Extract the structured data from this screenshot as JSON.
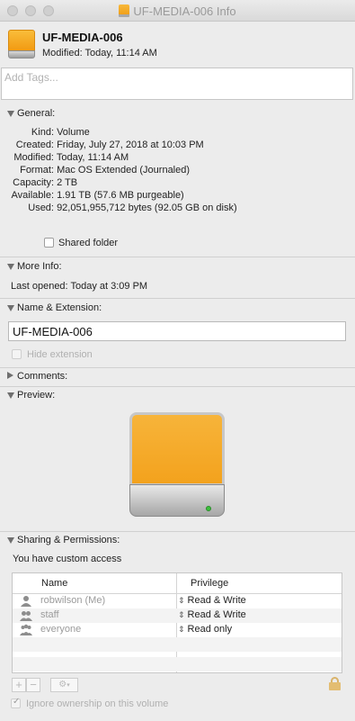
{
  "window": {
    "title": "UF-MEDIA-006 Info"
  },
  "header": {
    "name": "UF-MEDIA-006",
    "modified": "Modified: Today, 11:14 AM"
  },
  "tags": {
    "placeholder": "Add Tags..."
  },
  "general": {
    "label": "General:",
    "rows": [
      {
        "key": "Kind:",
        "value": "Volume"
      },
      {
        "key": "Created:",
        "value": "Friday, July 27, 2018 at 10:03 PM"
      },
      {
        "key": "Modified:",
        "value": "Today, 11:14 AM"
      },
      {
        "key": "Format:",
        "value": "Mac OS Extended (Journaled)"
      },
      {
        "key": "Capacity:",
        "value": "2 TB"
      },
      {
        "key": "Available:",
        "value": "1.91 TB (57.6 MB purgeable)"
      },
      {
        "key": "Used:",
        "value": "92,051,955,712 bytes (92.05 GB on disk)"
      }
    ],
    "shared_folder_label": "Shared folder"
  },
  "more_info": {
    "label": "More Info:",
    "last_opened": "Last opened:",
    "last_opened_value": "Today at 3:09 PM"
  },
  "name_extension": {
    "label": "Name & Extension:",
    "value": "UF-MEDIA-006",
    "hide_extension_label": "Hide extension"
  },
  "comments": {
    "label": "Comments:"
  },
  "preview": {
    "label": "Preview:"
  },
  "sharing": {
    "label": "Sharing & Permissions:",
    "access_text": "You have custom access",
    "col_name": "Name",
    "col_privilege": "Privilege",
    "rows": [
      {
        "name": "robwilson (Me)",
        "privilege": "Read & Write",
        "icon": "user-icon"
      },
      {
        "name": "staff",
        "privilege": "Read & Write",
        "icon": "group-icon"
      },
      {
        "name": "everyone",
        "privilege": "Read only",
        "icon": "everyone-icon"
      }
    ],
    "ignore_ownership_label": "Ignore ownership on this volume"
  },
  "colors": {
    "drive_orange": "#f3a21d",
    "led_green": "#3cc03c"
  }
}
